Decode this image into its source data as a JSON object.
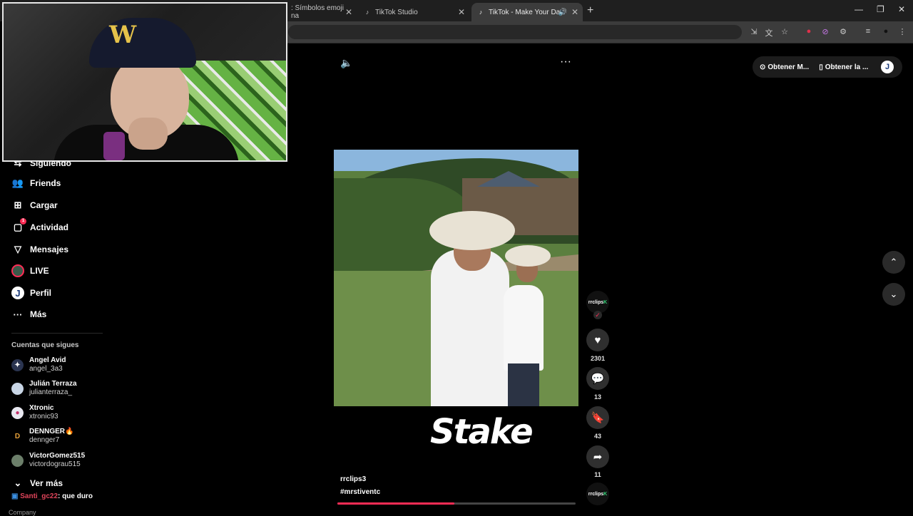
{
  "browser": {
    "tabs": [
      {
        "title": ": Símbolos emoji na",
        "active": false
      },
      {
        "title": "TikTok Studio",
        "active": false
      },
      {
        "title": "TikTok - Make Your Day",
        "active": true
      }
    ],
    "new_tab_icon": "+",
    "window_controls": [
      "minimize-icon",
      "restore-icon",
      "close-icon"
    ]
  },
  "sidebar": {
    "items": [
      {
        "label": "Siguiendo",
        "icon": "following-icon"
      },
      {
        "label": "Friends",
        "icon": "friends-icon"
      },
      {
        "label": "Cargar",
        "icon": "upload-icon"
      },
      {
        "label": "Actividad",
        "icon": "activity-icon",
        "badge": "1"
      },
      {
        "label": "Mensajes",
        "icon": "messages-icon"
      },
      {
        "label": "LIVE",
        "icon": "live-icon"
      },
      {
        "label": "Perfil",
        "icon": "profile-icon"
      },
      {
        "label": "Más",
        "icon": "more-icon"
      }
    ],
    "following_title": "Cuentas que sigues",
    "accounts": [
      {
        "name": "Angel Avid",
        "handle": "angel_3a3"
      },
      {
        "name": "Julián Terraza",
        "handle": "julianterraza_"
      },
      {
        "name": "Xtronic",
        "handle": "xtronic93"
      },
      {
        "name": "DENNGER🔥",
        "handle": "dennger7"
      },
      {
        "name": "VictorGomez515",
        "handle": "victordograu515"
      }
    ],
    "see_more": "Ver más",
    "chat": {
      "user": "Santi_gc22",
      "message": ": que duro"
    },
    "footer_partial": "Company"
  },
  "top_right": {
    "btn1": "Obtener M...",
    "btn2": "Obtener la ...",
    "avatar_letter": "J"
  },
  "video": {
    "brand_overlay": "Stake",
    "author": "rrclips3",
    "hashtag": "#mrstiventc",
    "progress_fraction": 0.49
  },
  "rail": {
    "creator_label": "rrclips",
    "creator_badge": "K",
    "likes": "2301",
    "comments": "13",
    "saves": "43",
    "shares": "11",
    "sound_label": "rrclips",
    "sound_badge": "K"
  },
  "colors": {
    "accent": "#fe2c55",
    "verified": "#37d67a"
  }
}
